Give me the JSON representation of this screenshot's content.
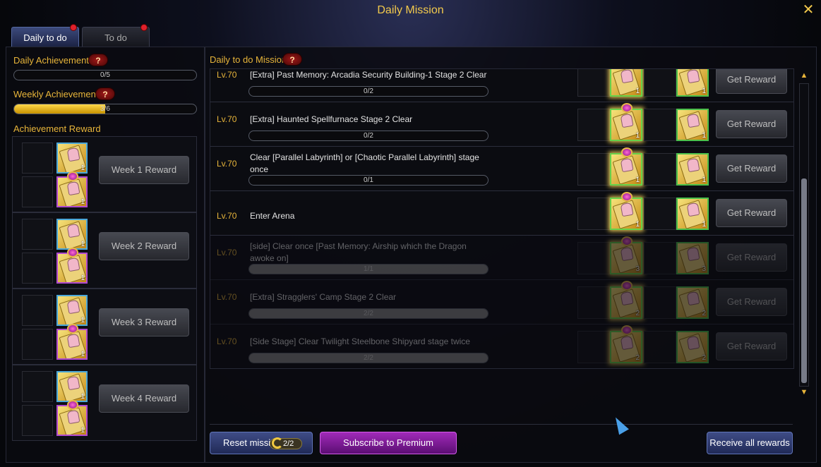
{
  "window": {
    "title": "Daily Mission",
    "close_icon": "close-icon"
  },
  "tabs": [
    {
      "label": "Daily to do",
      "active": true,
      "notification": true
    },
    {
      "label": "To do",
      "active": false,
      "notification": true
    }
  ],
  "left": {
    "daily_achievement": {
      "label": "Daily Achievement",
      "help": "?",
      "progress_text": "0/5",
      "progress": 0.0
    },
    "weekly_achievement": {
      "label": "Weekly Achievement",
      "help": "?",
      "progress_text": "3/6",
      "progress": 0.5
    },
    "achievement_reward_label": "Achievement Reward",
    "weeks": [
      {
        "button": "Week 1 Reward",
        "qty_top": "1",
        "qty_bottom": "1"
      },
      {
        "button": "Week 2 Reward",
        "qty_top": "1",
        "qty_bottom": "1"
      },
      {
        "button": "Week 3 Reward",
        "qty_top": "1",
        "qty_bottom": "1"
      },
      {
        "button": "Week 4 Reward",
        "qty_top": "1",
        "qty_bottom": "1"
      }
    ]
  },
  "right": {
    "header": "Daily to do Mission",
    "help": "?",
    "missions": [
      {
        "level": "Lv.70",
        "title": "[Extra] Past Memory: Arcadia Security Building-1 Stage 2 Clear",
        "progress": "0/2",
        "qty1": "1",
        "qty2": "1",
        "button": "Get Reward",
        "dim": false
      },
      {
        "level": "Lv.70",
        "title": "[Extra] Haunted Spellfurnace Stage 2 Clear",
        "progress": "0/2",
        "qty1": "1",
        "qty2": "1",
        "button": "Get Reward",
        "dim": false
      },
      {
        "level": "Lv.70",
        "title": "Clear [Parallel Labyrinth] or [Chaotic Parallel Labyrinth] stage once",
        "progress": "0/1",
        "qty1": "1",
        "qty2": "1",
        "button": "Get Reward",
        "dim": false
      },
      {
        "level": "Lv.70",
        "title": "Enter Arena",
        "progress": "",
        "qty1": "1",
        "qty2": "1",
        "button": "Get Reward",
        "dim": false
      },
      {
        "level": "Lv.70",
        "title": "[side] Clear once [Past Memory: Airship which the Dragon awoke on]",
        "progress": "1/1",
        "qty1": "3",
        "qty2": "3",
        "button": "Get Reward",
        "dim": true
      },
      {
        "level": "Lv.70",
        "title": "[Extra] Stragglers' Camp Stage 2 Clear",
        "progress": "2/2",
        "qty1": "2",
        "qty2": "2",
        "button": "Get Reward",
        "dim": true
      },
      {
        "level": "Lv.70",
        "title": "[Side Stage] Clear Twilight Steelbone Shipyard stage twice",
        "progress": "2/2",
        "qty1": "2",
        "qty2": "2",
        "button": "Get Reward",
        "dim": true
      }
    ]
  },
  "footer": {
    "reset_label": "Reset mission",
    "reset_count": "2/2",
    "premium_label": "Subscribe to Premium",
    "receive_all_label": "Receive all rewards"
  },
  "colors": {
    "gold": "#e8b53a",
    "premium": "#a02ab8",
    "accent_blue": "#3f4c86"
  }
}
